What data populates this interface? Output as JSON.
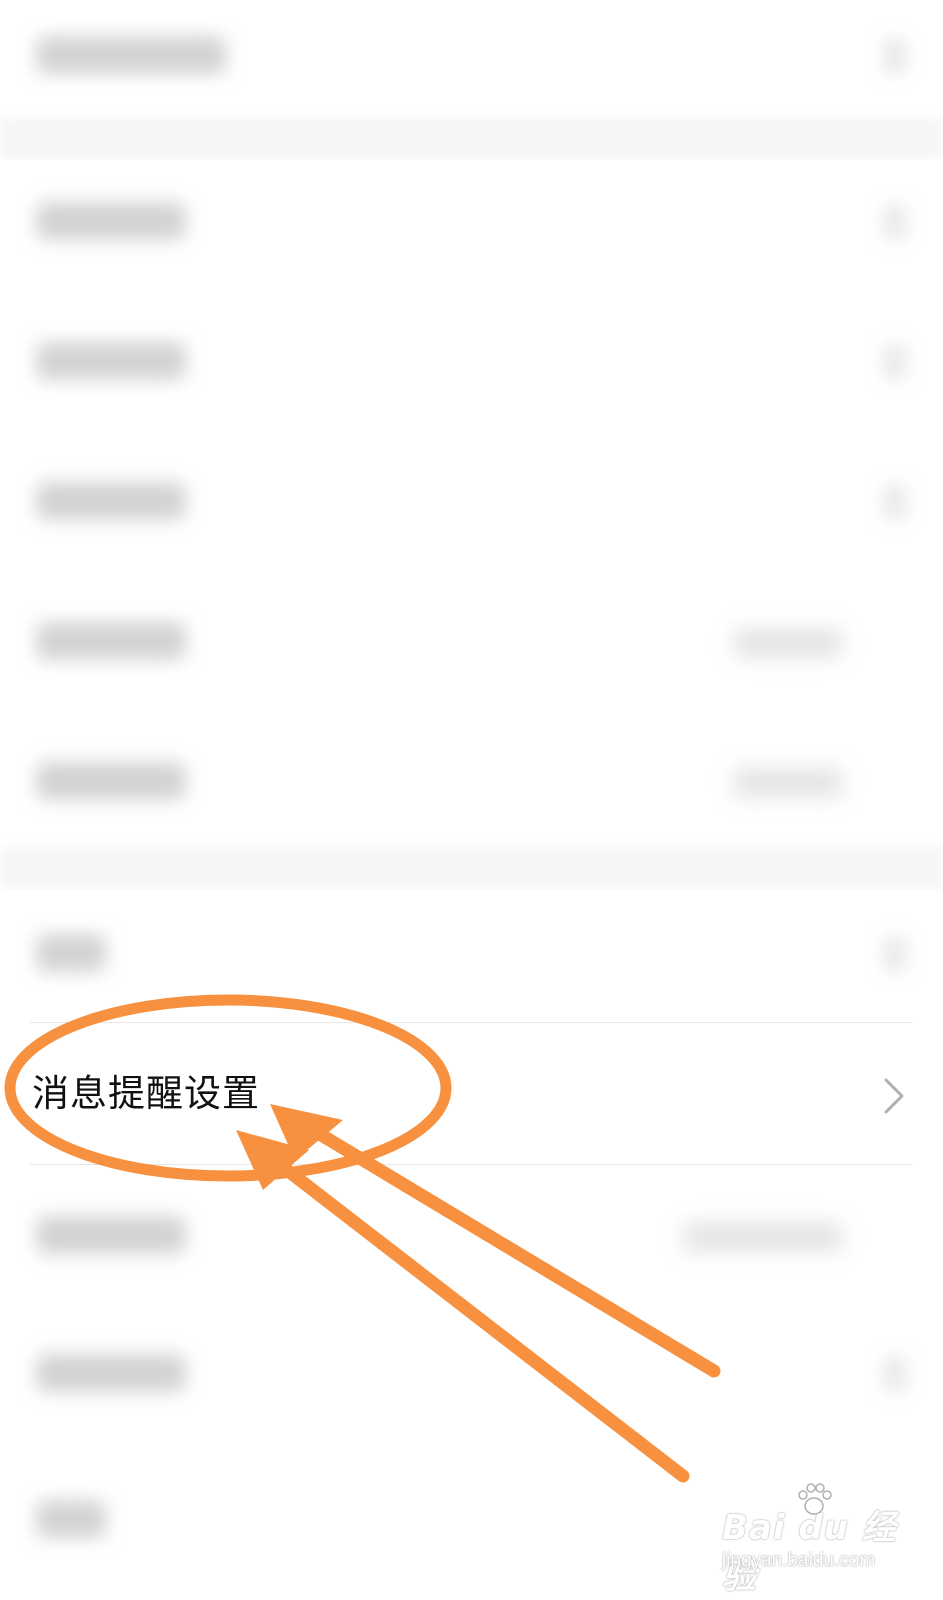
{
  "settings": {
    "highlighted_item": {
      "label": "消息提醒设置",
      "chevron_icon": "chevron-right-icon"
    }
  },
  "annotation": {
    "color": "#f7913f",
    "shapes": [
      "ellipse-highlight",
      "arrow",
      "arrow"
    ]
  },
  "watermark": {
    "logo_text": "Bai du 经验",
    "url_text": "jingyan.baidu.com"
  }
}
